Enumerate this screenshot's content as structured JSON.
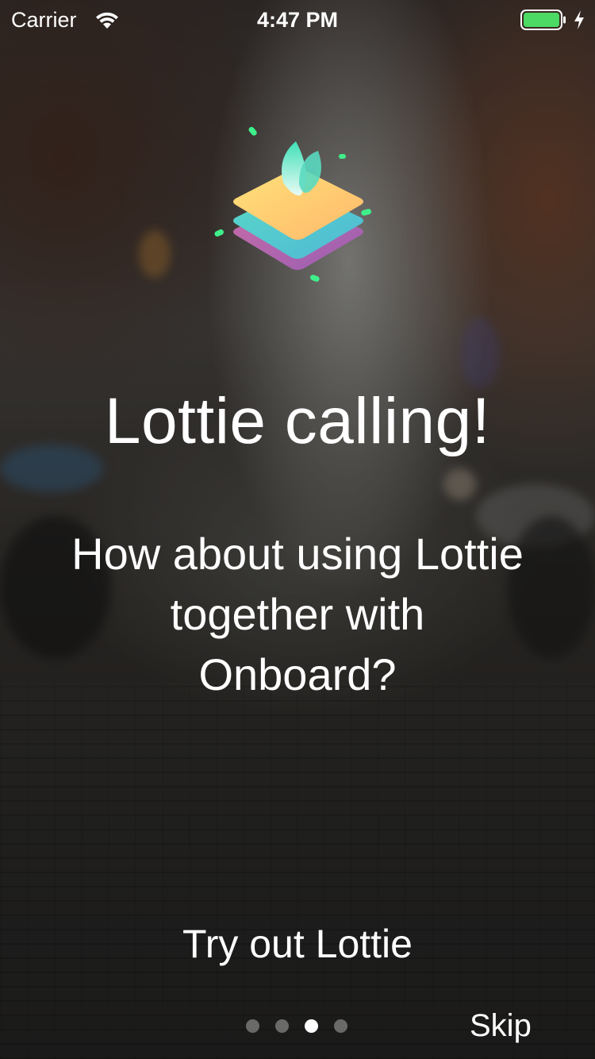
{
  "status_bar": {
    "carrier": "Carrier",
    "time": "4:47 PM",
    "battery_color": "#4cd964"
  },
  "logo": {
    "icon": "lottie-layers-leaf-icon"
  },
  "onboarding": {
    "title": "Lottie calling!",
    "subtitle_lines": [
      "How about using Lottie",
      "together with",
      "Onboard?"
    ],
    "action_label": "Try out Lottie",
    "skip_label": "Skip",
    "page_count": 4,
    "current_page": 3
  }
}
